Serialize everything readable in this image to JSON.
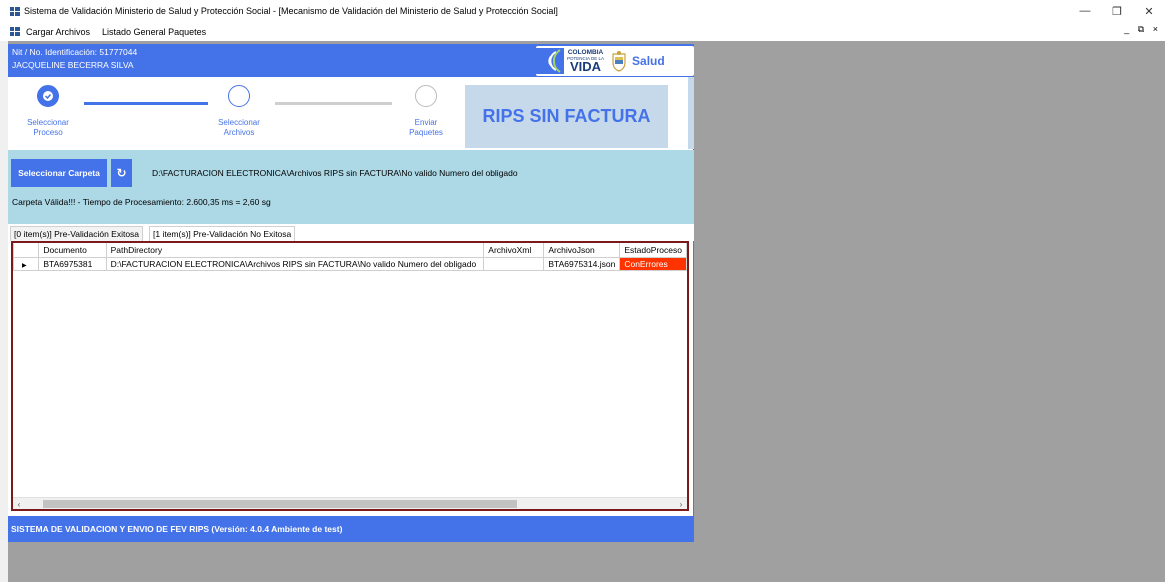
{
  "window": {
    "title": "Sistema de Validación Ministerio de Salud y Protección Social - [Mecanismo de Validación del Ministerio de Salud y Protección Social]",
    "minimize_glyph": "—",
    "restore_glyph": "❐",
    "close_glyph": "✕"
  },
  "menu": {
    "items": [
      "Cargar Archivos",
      "Listado General Paquetes"
    ],
    "mdi_controls": "_ ⧉ ×"
  },
  "user": {
    "id_line": "Nit / No. Identificación: 51777044",
    "name": "JACQUELINE BECERRA SILVA"
  },
  "logo": {
    "colombia": "COLOMBIA",
    "potencia": "POTENCIA DE LA",
    "vida": "VIDA",
    "salud": "Salud"
  },
  "steps": [
    {
      "line1": "Seleccionar",
      "line2": "Proceso",
      "state": "done"
    },
    {
      "line1": "Seleccionar",
      "line2": "Archivos",
      "state": "pending"
    },
    {
      "line1": "Enviar",
      "line2": "Paquetes",
      "state": "pending"
    }
  ],
  "banner": "RIPS SIN FACTURA",
  "toolbar": {
    "select_button": "Seleccionar Carpeta",
    "refresh_glyph": "↻",
    "path": "D:\\FACTURACION ELECTRONICA\\Archivos RIPS sin FACTURA\\No valido Numero del obligado",
    "status": "Carpeta Válida!!! - Tiempo de Procesamiento: 2.600,35 ms = 2,60 sg"
  },
  "tabs": [
    {
      "label": "[0 item(s)] Pre-Validación Exitosa",
      "active": false
    },
    {
      "label": "[1 item(s)] Pre-Validación No Exitosa",
      "active": true
    }
  ],
  "grid": {
    "columns": [
      "Documento",
      "PathDirectory",
      "ArchivoXml",
      "ArchivoJson",
      "EstadoProceso"
    ],
    "rows": [
      {
        "documento": "BTA6975381",
        "path": "D:\\FACTURACION ELECTRONICA\\Archivos RIPS sin FACTURA\\No valido Numero del obligado",
        "xml": "",
        "json": "BTA6975314.json",
        "estado": "ConErrores"
      }
    ]
  },
  "footer": "SISTEMA DE VALIDACION Y ENVIO DE FEV RIPS  (Versión: 4.0.4 Ambiente de test)",
  "colors": {
    "primary": "#4472e8",
    "light_blue": "#add8e6",
    "banner_bg": "#c6d9ea",
    "error": "#ff3300",
    "grid_border": "#7a1a1a"
  }
}
